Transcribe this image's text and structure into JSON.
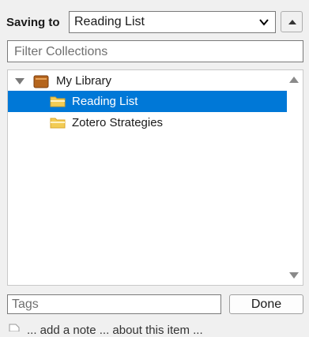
{
  "header": {
    "saving_label": "Saving to",
    "selected_collection": "Reading List",
    "icons": {
      "select": "chevron-down-icon",
      "collapse": "chevron-up-icon"
    }
  },
  "filter": {
    "placeholder": "Filter Collections"
  },
  "tree": {
    "library": {
      "label": "My Library",
      "icon": "library-icon",
      "expanded": true
    },
    "collections": [
      {
        "label": "Reading List",
        "selected": true,
        "icon": "folder-icon"
      },
      {
        "label": "Zotero Strategies",
        "selected": false,
        "icon": "folder-icon"
      }
    ]
  },
  "footer": {
    "tags_placeholder": "Tags",
    "done_label": "Done",
    "cut_off_text": "... add a note ... about this item ..."
  },
  "colors": {
    "selection": "#0078d7",
    "folder": "#f2cc55",
    "library": "#b5651d"
  }
}
